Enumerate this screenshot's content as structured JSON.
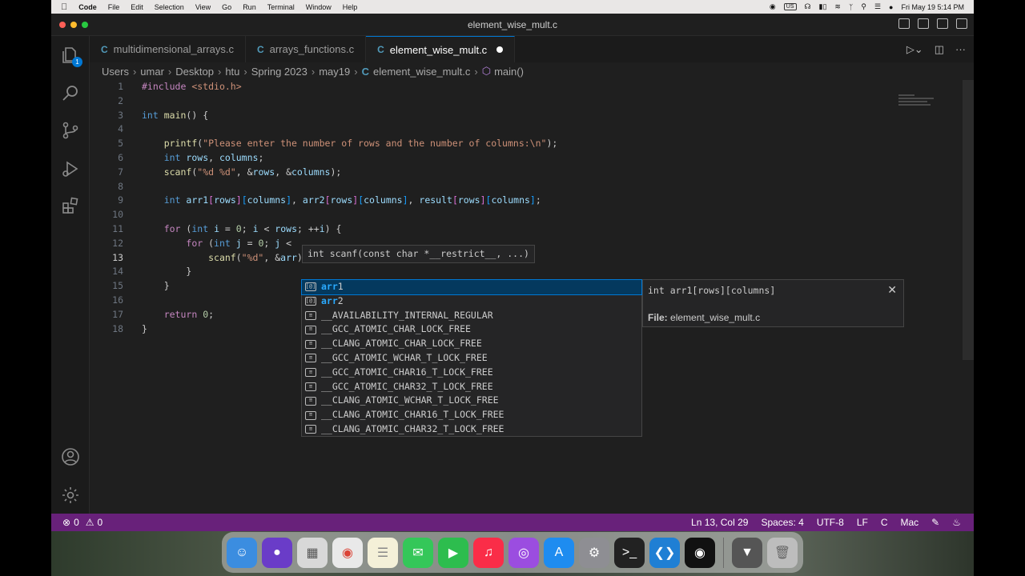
{
  "menubar": {
    "app": "Code",
    "items": [
      "File",
      "Edit",
      "Selection",
      "View",
      "Go",
      "Run",
      "Terminal",
      "Window",
      "Help"
    ],
    "input_source": "US",
    "clock": "Fri May 19  5:14 PM"
  },
  "window": {
    "title": "element_wise_mult.c"
  },
  "tabs": [
    {
      "label": "multidimensional_arrays.c",
      "icon": "C"
    },
    {
      "label": "arrays_functions.c",
      "icon": "C"
    },
    {
      "label": "element_wise_mult.c",
      "icon": "C",
      "active": true,
      "modified": true
    }
  ],
  "breadcrumb": {
    "parts": [
      "Users",
      "umar",
      "Desktop",
      "htu",
      "Spring 2023",
      "may19"
    ],
    "file": "element_wise_mult.c",
    "file_icon": "C",
    "symbol": "main()"
  },
  "editor": {
    "line_numbers": [
      "1",
      "2",
      "3",
      "4",
      "5",
      "6",
      "7",
      "8",
      "9",
      "10",
      "11",
      "12",
      "13",
      "14",
      "15",
      "16",
      "17",
      "18"
    ],
    "current_line": "13"
  },
  "signature_help": {
    "text": "int scanf(const char *__restrict__, ...)"
  },
  "suggest": {
    "items": [
      {
        "pre": "",
        "hl": "arr",
        "post": "1",
        "kind": "variable"
      },
      {
        "pre": "",
        "hl": "arr",
        "post": "2",
        "kind": "variable"
      },
      {
        "text": "__AVAILABILITY_INTERNAL_REGULAR",
        "kind": "constant"
      },
      {
        "text": "__GCC_ATOMIC_CHAR_LOCK_FREE",
        "kind": "constant"
      },
      {
        "text": "__CLANG_ATOMIC_CHAR_LOCK_FREE",
        "kind": "constant"
      },
      {
        "text": "__GCC_ATOMIC_WCHAR_T_LOCK_FREE",
        "kind": "constant"
      },
      {
        "text": "__GCC_ATOMIC_CHAR16_T_LOCK_FREE",
        "kind": "constant"
      },
      {
        "text": "__GCC_ATOMIC_CHAR32_T_LOCK_FREE",
        "kind": "constant"
      },
      {
        "text": "__CLANG_ATOMIC_WCHAR_T_LOCK_FREE",
        "kind": "constant"
      },
      {
        "text": "__CLANG_ATOMIC_CHAR16_T_LOCK_FREE",
        "kind": "constant"
      },
      {
        "text": "__CLANG_ATOMIC_CHAR32_T_LOCK_FREE",
        "kind": "constant"
      }
    ],
    "detail_signature": "int arr1[rows][columns]",
    "detail_file_label": "File:",
    "detail_file": "element_wise_mult.c"
  },
  "statusbar": {
    "errors": "0",
    "warnings": "0",
    "position": "Ln 13, Col 29",
    "spaces": "Spaces: 4",
    "encoding": "UTF-8",
    "eol": "LF",
    "language": "C",
    "platform": "Mac"
  },
  "colors": {
    "statusbar": "#68217a",
    "accent": "#0078d4",
    "c_icon": "#519aba"
  }
}
